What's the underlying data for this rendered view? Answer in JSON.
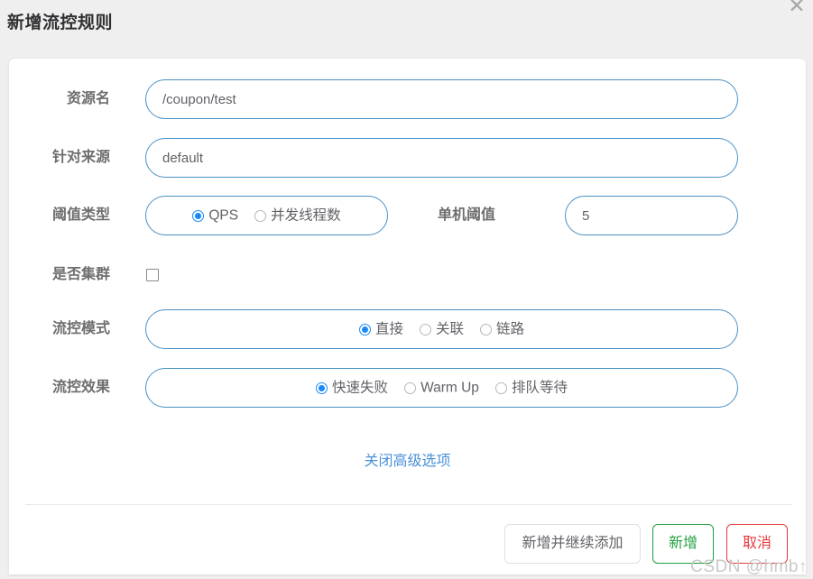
{
  "dialog": {
    "title": "新增流控规则",
    "close_icon": "close-icon",
    "close_glyph": "✕"
  },
  "form": {
    "rows": [
      {
        "label": "资源名"
      },
      {
        "label": "针对来源"
      },
      {
        "label": "阈值类型"
      },
      {
        "label": "是否集群"
      },
      {
        "label": "流控模式"
      },
      {
        "label": "流控效果"
      }
    ],
    "resource_name": {
      "label": "资源名",
      "value": "/coupon/test",
      "placeholder": "资源名"
    },
    "origin": {
      "label": "针对来源",
      "value": "default",
      "placeholder": "default"
    },
    "threshold_type": {
      "label": "阈值类型",
      "options": [
        {
          "label": "QPS",
          "checked": true
        },
        {
          "label": "并发线程数",
          "checked": false
        }
      ]
    },
    "single_threshold": {
      "label": "单机阈值",
      "value": "5",
      "placeholder": ""
    },
    "cluster": {
      "label": "是否集群",
      "checked": false
    },
    "flow_mode": {
      "label": "流控模式",
      "options": [
        {
          "label": "直接",
          "checked": true
        },
        {
          "label": "关联",
          "checked": false
        },
        {
          "label": "链路",
          "checked": false
        }
      ]
    },
    "flow_effect": {
      "label": "流控效果",
      "options": [
        {
          "label": "快速失败",
          "checked": true
        },
        {
          "label": "Warm Up",
          "checked": false
        },
        {
          "label": "排队等待",
          "checked": false
        }
      ]
    }
  },
  "advanced_link": "关闭高级选项",
  "footer": {
    "add_and_continue": "新增并继续添加",
    "add": "新增",
    "cancel": "取消"
  },
  "watermark": "CSDN @hmb↑",
  "colors": {
    "accent_blue": "#1989fa",
    "border_blue": "#4a90c4",
    "link_blue": "#4a90d9",
    "success_green": "#22a03f",
    "danger_red": "#e4393c",
    "page_bg": "#efefef",
    "card_bg": "#ffffff",
    "label_gray": "#6e6e6e"
  }
}
